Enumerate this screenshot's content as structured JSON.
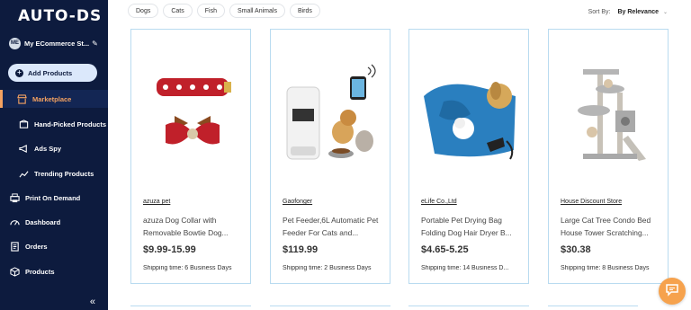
{
  "brand": {
    "logo": "AUTO-DS"
  },
  "store": {
    "initials": "ME",
    "name": "My ECommerce St..."
  },
  "sidebar": {
    "add_products": "Add Products",
    "items": [
      {
        "label": "Marketplace",
        "icon": "shop-icon"
      },
      {
        "label": "Hand-Picked Products",
        "icon": "box-icon"
      },
      {
        "label": "Ads Spy",
        "icon": "megaphone-icon"
      },
      {
        "label": "Trending Products",
        "icon": "trend-icon"
      },
      {
        "label": "Print On Demand",
        "icon": "printer-icon"
      },
      {
        "label": "Dashboard",
        "icon": "gauge-icon"
      },
      {
        "label": "Orders",
        "icon": "orders-icon"
      },
      {
        "label": "Products",
        "icon": "cube-icon"
      }
    ],
    "collapse": "«"
  },
  "filters": [
    "Dogs",
    "Cats",
    "Fish",
    "Small Animals",
    "Birds"
  ],
  "sort": {
    "label": "Sort By:",
    "value": "By Relevance"
  },
  "products": [
    {
      "vendor": "azuza pet",
      "title": "azuza Dog Collar with Removable Bowtie Dog...",
      "price": "$9.99-15.99",
      "shipping": "Shipping time: 6 Business Days"
    },
    {
      "vendor": "Gaofonger",
      "title": "Pet Feeder,6L Automatic Pet Feeder For Cats and...",
      "price": "$119.99",
      "shipping": "Shipping time: 2 Business Days"
    },
    {
      "vendor": "eLife Co.,Ltd",
      "title": "Portable Pet Drying Bag Folding Dog Hair Dryer B...",
      "price": "$4.65-5.25",
      "shipping": "Shipping time: 14 Business D..."
    },
    {
      "vendor": "House Discount Store",
      "title": "Large Cat Tree Condo Bed House Tower Scratching...",
      "price": "$30.38",
      "shipping": "Shipping time: 8 Business Days"
    }
  ],
  "colors": {
    "sidebar_bg": "#0d1b3e",
    "accent": "#f4a261",
    "card_border": "#b9dbf0",
    "chat": "#f6a24d"
  }
}
